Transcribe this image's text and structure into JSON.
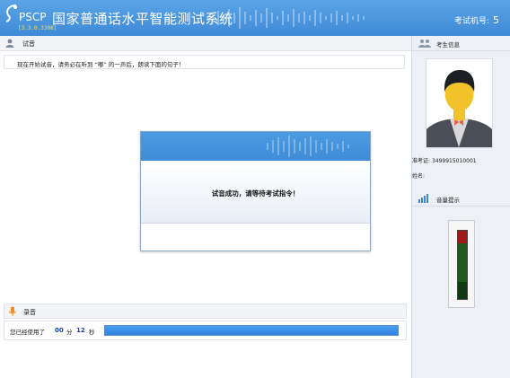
{
  "header": {
    "brand": "PSCP",
    "title": "国家普通话水平智能测试系统",
    "version": "[3.3.0.3308]",
    "exam_id_label": "考试机号:",
    "exam_id_value": "5"
  },
  "main": {
    "section_title": "试音",
    "instruction": "现在开始试音，请务必在听到 “嘟” 的一声后，朗读下面的句子！",
    "dialog_message": "试音成功，请等待考试指令！"
  },
  "recording": {
    "section_title": "录音",
    "elapsed_prefix": "您已经使用了",
    "minutes": "00",
    "minute_unit": "分",
    "seconds": "12",
    "second_unit": "秒",
    "progress_fraction": 1.0
  },
  "sidebar": {
    "candidate_title": "考生信息",
    "ticket_label": "准考证:",
    "ticket_value": "3499915010001",
    "name_label": "姓名:",
    "name_value": "",
    "volume_title": "音量提示",
    "volume_level_fraction": 0.3
  },
  "colors": {
    "header_blue": "#3f8ad6",
    "progress_blue": "#2f80dc",
    "version_yellow": "#ffe14a",
    "meter_red": "#a01818"
  }
}
